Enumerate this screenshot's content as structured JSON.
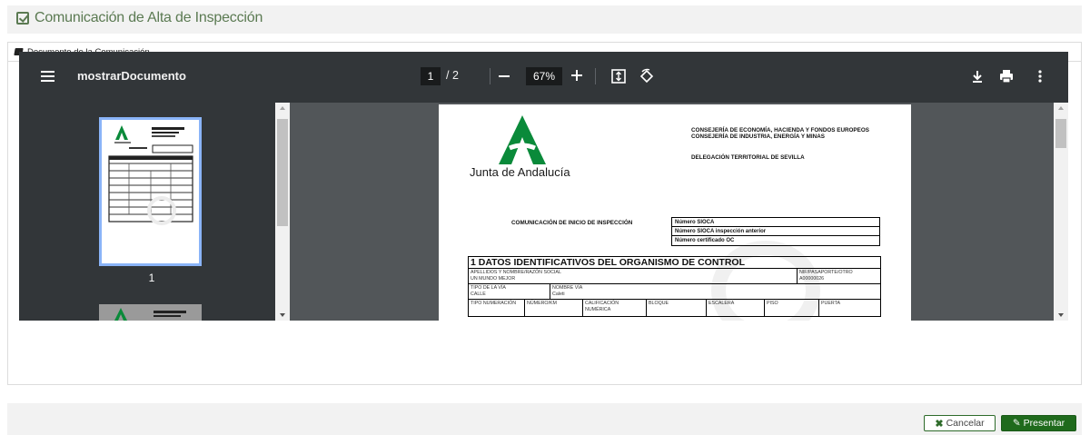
{
  "header": {
    "title": "Comunicación de Alta de Inspección",
    "icon": "checkbox-icon"
  },
  "panel": {
    "title": "Documento de la Comunicación",
    "icon": "book-icon"
  },
  "viewer": {
    "title": "mostrarDocumento",
    "current_page": "1",
    "total_pages": "/ 2",
    "zoom": "67%",
    "thumbnail_page_number": "1"
  },
  "document": {
    "brand": "Junta de Andalucía",
    "consejeria": "CONSEJERÍA DE ECONOMÍA, HACIENDA Y FONDOS EUROPEOS\nCONSEJERÍA DE INDUSTRIA, ENERGÍA Y MINAS",
    "delegacion": "DELEGACIÓN TERRITORIAL DE SEVILLA",
    "comm_title": "COMUNICACIÓN DE INICIO DE INSPECCIÓN",
    "sioca_fields": [
      "Número SIOCA",
      "Número SIOCA inspección anterior",
      "Número certificado OC"
    ],
    "section_title": "1 DATOS IDENTIFICATIVOS DEL ORGANISMO DE CONTROL",
    "row1": {
      "label_name": "APELLIDOS Y NOMBRE/RAZÓN SOCIAL",
      "value_name": "UN MUNDO MEJOR",
      "label_nif": "NIF/PASAPORTE/OTRO",
      "value_nif": "A00000026"
    },
    "row2": {
      "label_tipo": "TIPO DE LA VÍA",
      "value_tipo": "CALLE",
      "label_nombre": "NOMBRE VÍA",
      "value_nombre": "Caleti"
    },
    "row3": [
      "TIPO NUMERACIÓN",
      "NÚMERO/KM",
      "CALIFICACIÓN NUMÉRICA",
      "BLOQUE",
      "ESCALERA",
      "PISO",
      "PUERTA"
    ]
  },
  "actions": {
    "cancel": "Cancelar",
    "submit": "Presentar"
  },
  "colors": {
    "accent": "#1f6a1c",
    "title_green": "#5b7a52",
    "logo_green": "#0a8a3a",
    "toolbar": "#323639"
  }
}
